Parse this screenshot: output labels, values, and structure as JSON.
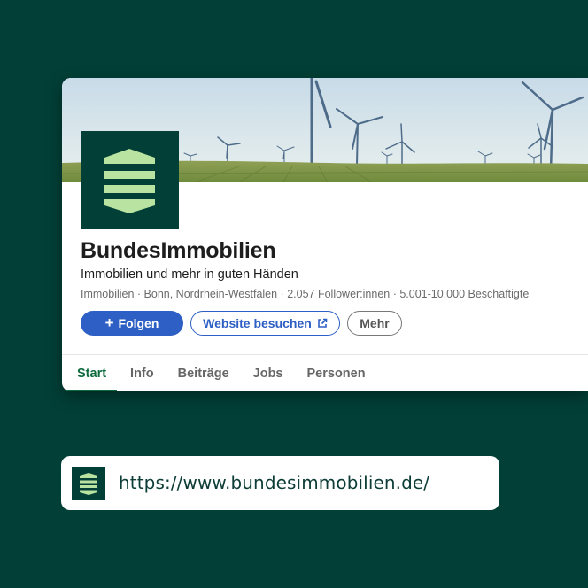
{
  "company": {
    "name": "BundesImmobilien",
    "tagline": "Immobilien und mehr in guten Händen",
    "meta": "Immobilien · Bonn, Nordrhein-Westfalen · 2.057 Follower:innen · 5.001-10.000 Beschäftigte"
  },
  "actions": {
    "follow_label": "Folgen",
    "website_label": "Website besuchen",
    "more_label": "Mehr"
  },
  "tabs": [
    {
      "label": "Start",
      "active": true
    },
    {
      "label": "Info",
      "active": false
    },
    {
      "label": "Beiträge",
      "active": false
    },
    {
      "label": "Jobs",
      "active": false
    },
    {
      "label": "Personen",
      "active": false
    }
  ],
  "url": "https://www.bundesimmobilien.de/",
  "icons": {
    "logo": "bundesimmobilien-logo-icon",
    "plus": "plus-icon",
    "external": "external-link-icon"
  },
  "colors": {
    "background": "#023f36",
    "accent_blue": "#2e5fc4",
    "active_tab": "#0d6b3e",
    "logo_mark": "#b9e3a0"
  }
}
